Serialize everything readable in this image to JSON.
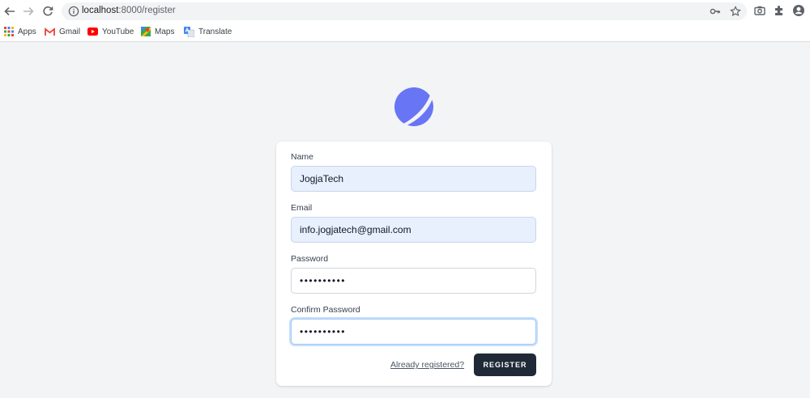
{
  "browser": {
    "url_host": "localhost",
    "url_path": ":8000/register",
    "bookmarks": [
      {
        "label": "Apps",
        "icon": "apps-grid-icon"
      },
      {
        "label": "Gmail",
        "icon": "gmail-icon"
      },
      {
        "label": "YouTube",
        "icon": "youtube-icon"
      },
      {
        "label": "Maps",
        "icon": "maps-icon"
      },
      {
        "label": "Translate",
        "icon": "translate-icon"
      }
    ]
  },
  "brand": {
    "accent": "#6875f5"
  },
  "form": {
    "name_label": "Name",
    "name_value": "JogjaTech",
    "email_label": "Email",
    "email_value": "info.jogjatech@gmail.com",
    "password_label": "Password",
    "password_value": "••••••••••",
    "confirm_label": "Confirm Password",
    "confirm_value": "••••••••••",
    "already_link": "Already registered?",
    "submit_label": "REGISTER"
  }
}
